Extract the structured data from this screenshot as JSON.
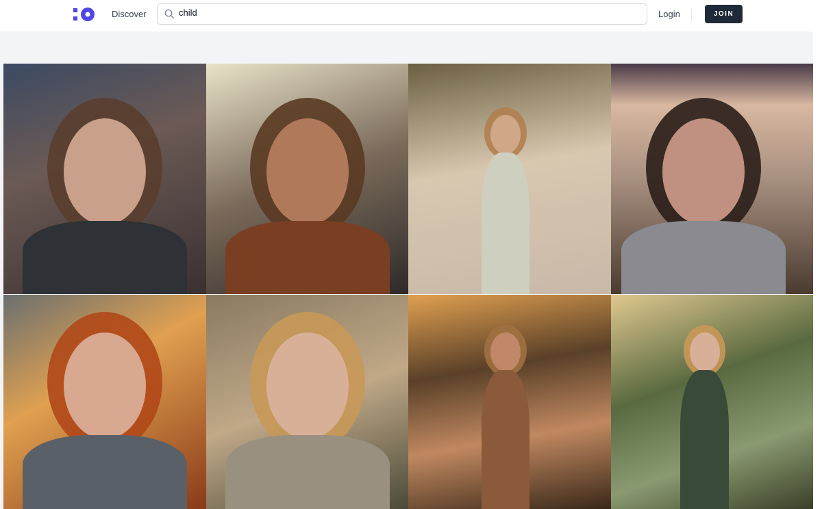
{
  "header": {
    "logo": "logo-icon",
    "discover_label": "Discover",
    "search": {
      "value": "child",
      "icon": "search-icon"
    },
    "login_label": "Login",
    "join_label": "JOIN",
    "accent": "#4f46e5",
    "join_color": "#1f2937"
  },
  "gallery": {
    "images": [
      {
        "subject": "girl-curly-hair-city",
        "bg": "linear-gradient(160deg,#3b4a63 0%,#6b5a55 40%,#3a3030 100%)",
        "skin": "#c9a08a",
        "hair": "#5a3e2e",
        "cloth": "#2e3136"
      },
      {
        "subject": "boy-freckles-street",
        "bg": "linear-gradient(160deg,#e9e2c8 0%,#7a6a5a 50%,#2e2a28 100%)",
        "skin": "#b07a5a",
        "hair": "#5a3a22",
        "cloth": "#7a3e22"
      },
      {
        "subject": "boy-sand-dunes",
        "bg": "linear-gradient(170deg,#6b6040 0%,#d8c8b0 45%,#c8b8a8 100%)",
        "skin": "#d0a888",
        "hair": "#b08050",
        "cloth": "#cfcfc0"
      },
      {
        "subject": "girl-hood-dunes",
        "bg": "linear-gradient(180deg,#4a3a48 0%,#d8b8a0 18%,#a89080 50%,#4a3a30 100%)",
        "skin": "#c09080",
        "hair": "#2a1e18",
        "cloth": "#8a8a90"
      },
      {
        "subject": "red-haired-girl",
        "bg": "linear-gradient(150deg,#6a7070 0%,#e0a050 40%,#8a3a18 100%)",
        "skin": "#d8a890",
        "hair": "#b04818",
        "cloth": "#5a6068"
      },
      {
        "subject": "boy-blond-dunes",
        "bg": "linear-gradient(160deg,#8a7a60 0%,#c0a888 50%,#4a4a38 100%)",
        "skin": "#d8b098",
        "hair": "#c89858",
        "cloth": "#9a9080"
      },
      {
        "subject": "boy-hat-sunset",
        "bg": "linear-gradient(170deg,#e0a050 0%,#5a4028 35%,#c08860 65%,#3a2818 100%)",
        "skin": "#c08868",
        "hair": "#a07040",
        "cloth": "#8a5a3a"
      },
      {
        "subject": "boy-grass-path",
        "bg": "linear-gradient(160deg,#e0c890 0%,#5a6a40 40%,#8a9a70 70%,#3a4028 100%)",
        "skin": "#d8b098",
        "hair": "#c89858",
        "cloth": "#3a4a38"
      }
    ]
  }
}
